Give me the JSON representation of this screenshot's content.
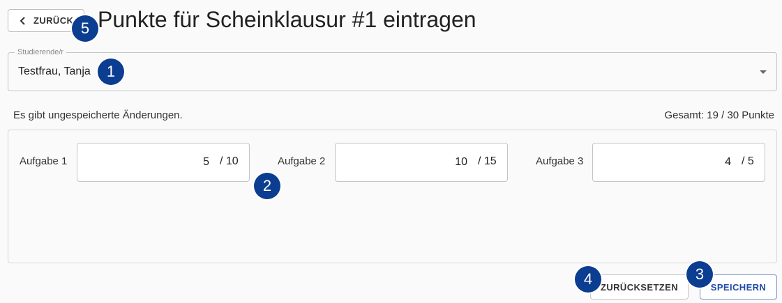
{
  "header": {
    "back_label": "ZURÜCK",
    "title": "Punkte für Scheinklausur #1 eintragen"
  },
  "student_select": {
    "legend": "Studierende/r",
    "value": "Testfrau, Tanja"
  },
  "status": {
    "unsaved": "Es gibt ungespeicherte Änderungen.",
    "total": "Gesamt: 19 / 30 Punkte"
  },
  "tasks": [
    {
      "label": "Aufgabe 1",
      "points": "5",
      "max": "/ 10"
    },
    {
      "label": "Aufgabe 2",
      "points": "10",
      "max": "/ 15"
    },
    {
      "label": "Aufgabe 3",
      "points": "4",
      "max": "/ 5"
    }
  ],
  "actions": {
    "reset_label": "ZURÜCKSETZEN",
    "save_label": "SPEICHERN"
  },
  "annotations": {
    "badge_1": "1",
    "badge_2": "2",
    "badge_3": "3",
    "badge_4": "4",
    "badge_5": "5"
  },
  "colors": {
    "badge": "#0b3d91",
    "primary": "#1f4aa8"
  }
}
